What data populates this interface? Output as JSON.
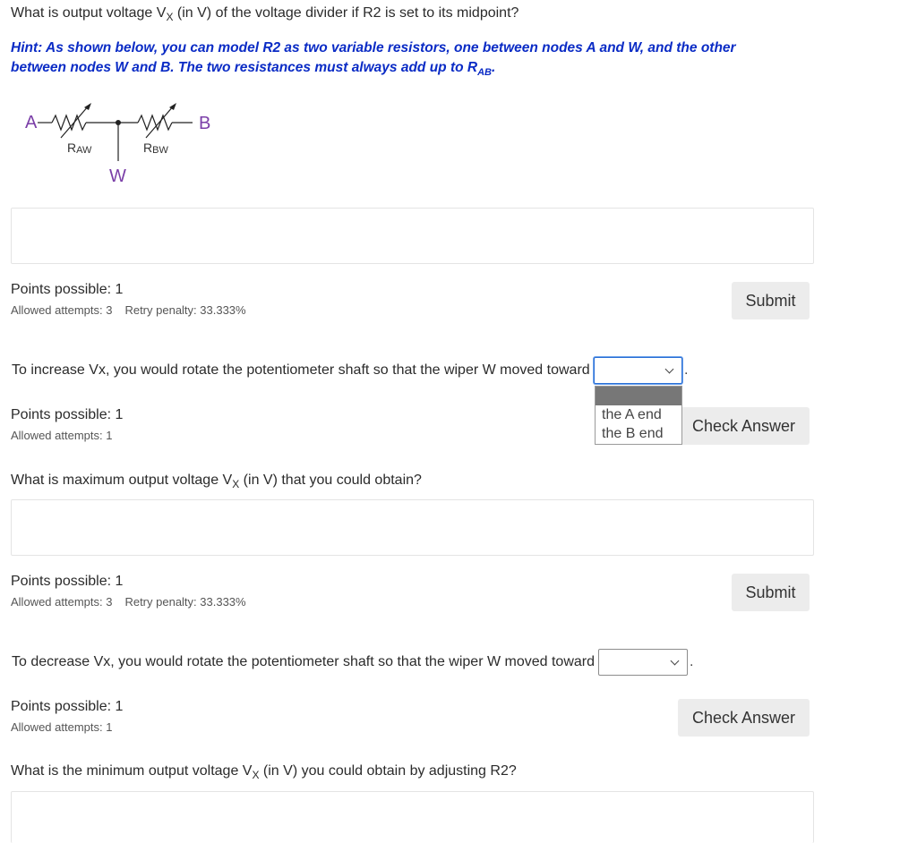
{
  "q1": {
    "pre": "What is output voltage V",
    "sub": "X",
    "post": " (in V) of the voltage divider if R2 is set to its midpoint?"
  },
  "hint": {
    "text": "Hint: As shown below, you can model R2 as two variable resistors, one between nodes A and W, and the other between nodes W and B. The two resistances must always add up to R",
    "sub": "AB",
    "end": "."
  },
  "diagram": {
    "node_a": "A",
    "node_b": "B",
    "node_w": "W",
    "r_aw": "R",
    "r_aw_sub": "AW",
    "r_bw": "R",
    "r_bw_sub": "BW",
    "label_color": "#7b3fa8"
  },
  "block1": {
    "points": "Points possible: 1",
    "attempts": "Allowed attempts: 3",
    "penalty": "Retry penalty: 33.333%",
    "button": "Submit"
  },
  "q2": {
    "text": "To increase Vx, you would rotate the potentiometer shaft so that the wiper W moved toward",
    "selected": "",
    "options": [
      "",
      "the A end",
      "the B end"
    ],
    "period": "."
  },
  "block2": {
    "points": "Points possible: 1",
    "attempts": "Allowed attempts: 1",
    "button": "Check Answer"
  },
  "q3": {
    "pre": "What is maximum output voltage V",
    "sub": "X",
    "post": " (in V) that you could obtain?"
  },
  "block3": {
    "points": "Points possible: 1",
    "attempts": "Allowed attempts: 3",
    "penalty": "Retry penalty: 33.333%",
    "button": "Submit"
  },
  "q4": {
    "text": "To decrease Vx, you would rotate the potentiometer shaft so that the wiper W moved toward",
    "selected": "",
    "period": "."
  },
  "block4": {
    "points": "Points possible: 1",
    "attempts": "Allowed attempts: 1",
    "button": "Check Answer"
  },
  "q5": {
    "pre": "What is the minimum output voltage V",
    "sub": "X",
    "post": " (in V) you could obtain by adjusting R2?"
  },
  "colors": {
    "hint": "#0a2bc5",
    "button_bg": "#ececec",
    "focus": "#2a6fd6"
  }
}
